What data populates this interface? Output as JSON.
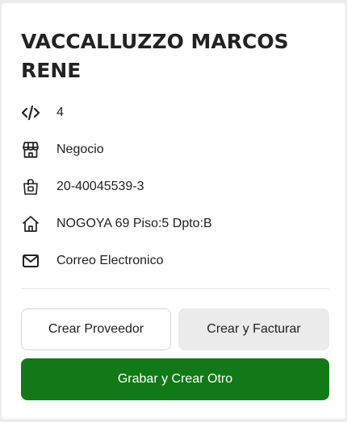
{
  "contact": {
    "name": "VACCALLUZZO MARCOS RENE",
    "id_value": "4",
    "type": "Negocio",
    "tax_id": "20-40045539-3",
    "address": "NOGOYA 69 Piso:5 Dpto:B",
    "email": "Correo Electronico"
  },
  "icons": {
    "id": "code-icon",
    "type": "store-icon",
    "tax_id": "shopping-bag-icon",
    "address": "home-icon",
    "email": "mail-icon"
  },
  "actions": {
    "create_supplier": "Crear Proveedor",
    "create_and_invoice": "Crear y Facturar",
    "save_and_create_other": "Grabar y Crear Otro"
  },
  "colors": {
    "primary_green": "#117a16",
    "secondary_grey": "#ebebeb"
  }
}
